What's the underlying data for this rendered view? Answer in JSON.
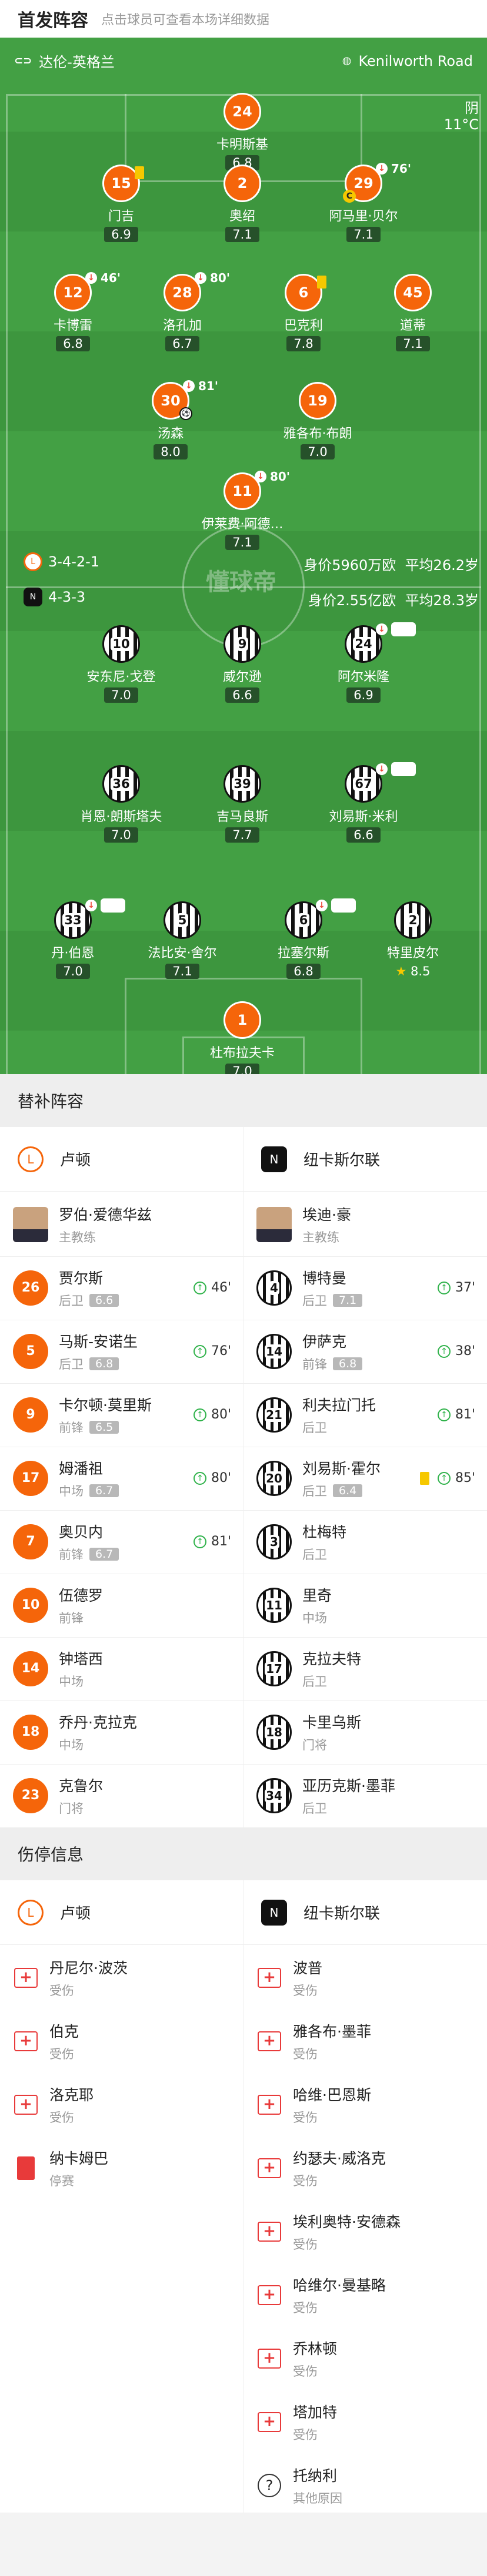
{
  "header": {
    "title": "首发阵容",
    "subtitle": "点击球员可查看本场详细数据"
  },
  "pitch": {
    "home_team": "达伦-英格兰",
    "away_venue": "Kenilworth Road",
    "weather": "阴",
    "temp": "11°C",
    "watermark": "懂球帝",
    "home": {
      "formation": "3-4-2-1",
      "value": "身价5960万欧",
      "age": "平均26.2岁"
    },
    "away": {
      "formation": "4-3-3",
      "value": "身价2.55亿欧",
      "age": "平均28.3岁"
    }
  },
  "players": [
    {
      "n": "24",
      "name": "卡明斯基",
      "r": "6.8",
      "side": "o"
    },
    {
      "n": "15",
      "name": "门吉",
      "r": "6.9",
      "side": "o",
      "card": true
    },
    {
      "n": "2",
      "name": "奥绍",
      "r": "7.1",
      "side": "o"
    },
    {
      "n": "29",
      "name": "阿马里·贝尔",
      "r": "7.1",
      "side": "o",
      "sub": "76'",
      "cap": true
    },
    {
      "n": "12",
      "name": "卡博雷",
      "r": "6.8",
      "side": "o",
      "sub": "46'"
    },
    {
      "n": "28",
      "name": "洛孔加",
      "r": "6.7",
      "side": "o",
      "sub": "80'"
    },
    {
      "n": "6",
      "name": "巴克利",
      "r": "7.8",
      "side": "o",
      "card": true
    },
    {
      "n": "45",
      "name": "道蒂",
      "r": "7.1",
      "side": "o"
    },
    {
      "n": "30",
      "name": "汤森",
      "r": "8.0",
      "side": "o",
      "sub": "81'",
      "ball": true
    },
    {
      "n": "19",
      "name": "雅各布·布朗",
      "r": "7.0",
      "side": "o"
    },
    {
      "n": "11",
      "name": "伊莱费·阿德…",
      "r": "7.1",
      "side": "o",
      "sub": "80'"
    },
    {
      "n": "10",
      "name": "安东尼·戈登",
      "r": "7.0",
      "side": "s"
    },
    {
      "n": "9",
      "name": "威尔逊",
      "r": "6.6",
      "side": "s"
    },
    {
      "n": "24",
      "name": "阿尔米隆",
      "r": "6.9",
      "side": "s",
      "sub": "81'"
    },
    {
      "n": "36",
      "name": "肖恩·朗斯塔夫",
      "r": "7.0",
      "side": "s"
    },
    {
      "n": "39",
      "name": "吉马良斯",
      "r": "7.7",
      "side": "s"
    },
    {
      "n": "67",
      "name": "刘易斯·米利",
      "r": "6.6",
      "side": "s",
      "sub": "38'"
    },
    {
      "n": "33",
      "name": "丹·伯恩",
      "r": "7.0",
      "side": "s",
      "sub": "85'"
    },
    {
      "n": "5",
      "name": "法比安·舍尔",
      "r": "7.1",
      "side": "s"
    },
    {
      "n": "6",
      "name": "拉塞尔斯",
      "r": "6.8",
      "side": "s",
      "sub": "37'"
    },
    {
      "n": "2",
      "name": "特里皮尔",
      "r": "8.5",
      "side": "s",
      "star": true
    },
    {
      "n": "1",
      "name": "杜布拉夫卡",
      "r": "7.0",
      "side": "o"
    }
  ],
  "subs": {
    "title": "替补阵容",
    "home": "卢顿",
    "away": "纽卡斯尔联",
    "rows": [
      [
        {
          "name": "罗伯·爱德华兹",
          "pos": "主教练",
          "coach": true
        },
        {
          "name": "埃迪·豪",
          "pos": "主教练",
          "coach": true
        }
      ],
      [
        {
          "n": "26",
          "name": "贾尔斯",
          "pos": "后卫",
          "r": "6.6",
          "min": "46'"
        },
        {
          "n": "4",
          "name": "博特曼",
          "pos": "后卫",
          "r": "7.1",
          "min": "37'"
        }
      ],
      [
        {
          "n": "5",
          "name": "马斯-安诺生",
          "pos": "后卫",
          "r": "6.8",
          "min": "76'"
        },
        {
          "n": "14",
          "name": "伊萨克",
          "pos": "前锋",
          "r": "6.8",
          "min": "38'"
        }
      ],
      [
        {
          "n": "9",
          "name": "卡尔顿·莫里斯",
          "pos": "前锋",
          "r": "6.5",
          "min": "80'"
        },
        {
          "n": "21",
          "name": "利夫拉门托",
          "pos": "后卫",
          "min": "81'"
        }
      ],
      [
        {
          "n": "17",
          "name": "姆潘祖",
          "pos": "中场",
          "r": "6.7",
          "min": "80'"
        },
        {
          "n": "20",
          "name": "刘易斯·霍尔",
          "pos": "后卫",
          "r": "6.4",
          "min": "85'",
          "card": true
        }
      ],
      [
        {
          "n": "7",
          "name": "奥贝内",
          "pos": "前锋",
          "r": "6.7",
          "min": "81'"
        },
        {
          "n": "3",
          "name": "杜梅特",
          "pos": "后卫"
        }
      ],
      [
        {
          "n": "10",
          "name": "伍德罗",
          "pos": "前锋"
        },
        {
          "n": "11",
          "name": "里奇",
          "pos": "中场"
        }
      ],
      [
        {
          "n": "14",
          "name": "钟塔西",
          "pos": "中场"
        },
        {
          "n": "17",
          "name": "克拉夫特",
          "pos": "后卫"
        }
      ],
      [
        {
          "n": "18",
          "name": "乔丹·克拉克",
          "pos": "中场"
        },
        {
          "n": "18",
          "name": "卡里乌斯",
          "pos": "门将"
        }
      ],
      [
        {
          "n": "23",
          "name": "克鲁尔",
          "pos": "门将"
        },
        {
          "n": "34",
          "name": "亚历克斯·墨菲",
          "pos": "后卫"
        }
      ]
    ]
  },
  "injuries": {
    "title": "伤停信息",
    "home": "卢顿",
    "away": "纽卡斯尔联",
    "left": [
      {
        "name": "丹尼尔·波茨",
        "status": "受伤",
        "icon": "medical-kit-icon"
      },
      {
        "name": "伯克",
        "status": "受伤",
        "icon": "medical-kit-icon"
      },
      {
        "name": "洛克耶",
        "status": "受伤",
        "icon": "medical-kit-icon"
      },
      {
        "name": "纳卡姆巴",
        "status": "停赛",
        "icon": "red-card-icon"
      }
    ],
    "right": [
      {
        "name": "波普",
        "status": "受伤",
        "icon": "medical-kit-icon"
      },
      {
        "name": "雅各布·墨菲",
        "status": "受伤",
        "icon": "medical-kit-icon"
      },
      {
        "name": "哈维·巴恩斯",
        "status": "受伤",
        "icon": "medical-kit-icon"
      },
      {
        "name": "约瑟夫·威洛克",
        "status": "受伤",
        "icon": "medical-kit-icon"
      },
      {
        "name": "埃利奥特·安德森",
        "status": "受伤",
        "icon": "medical-kit-icon"
      },
      {
        "name": "哈维尔·曼基略",
        "status": "受伤",
        "icon": "medical-kit-icon"
      },
      {
        "name": "乔林顿",
        "status": "受伤",
        "icon": "medical-kit-icon"
      },
      {
        "name": "塔加特",
        "status": "受伤",
        "icon": "medical-kit-icon"
      },
      {
        "name": "托纳利",
        "status": "其他原因",
        "icon": "question-icon"
      }
    ]
  }
}
